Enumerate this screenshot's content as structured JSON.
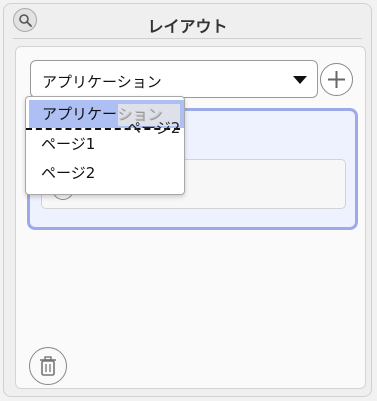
{
  "window": {
    "title": "レイアウト"
  },
  "selector": {
    "value": "アプリケーション"
  },
  "dropdown": {
    "items": [
      {
        "label": "アプリケーション",
        "selected": true
      },
      {
        "label": "ページ1",
        "selected": false
      },
      {
        "label": "ページ2",
        "selected": false
      }
    ]
  },
  "drag": {
    "ghost_label": "ページ2",
    "ghost_behind": "ション"
  },
  "icons": [
    "search-icon",
    "plus-icon",
    "trash-icon"
  ],
  "colors": {
    "drop_zone_border": "#9ea9e8",
    "drop_zone_fill": "#eef1fe",
    "selected_item": "#aebff3"
  }
}
